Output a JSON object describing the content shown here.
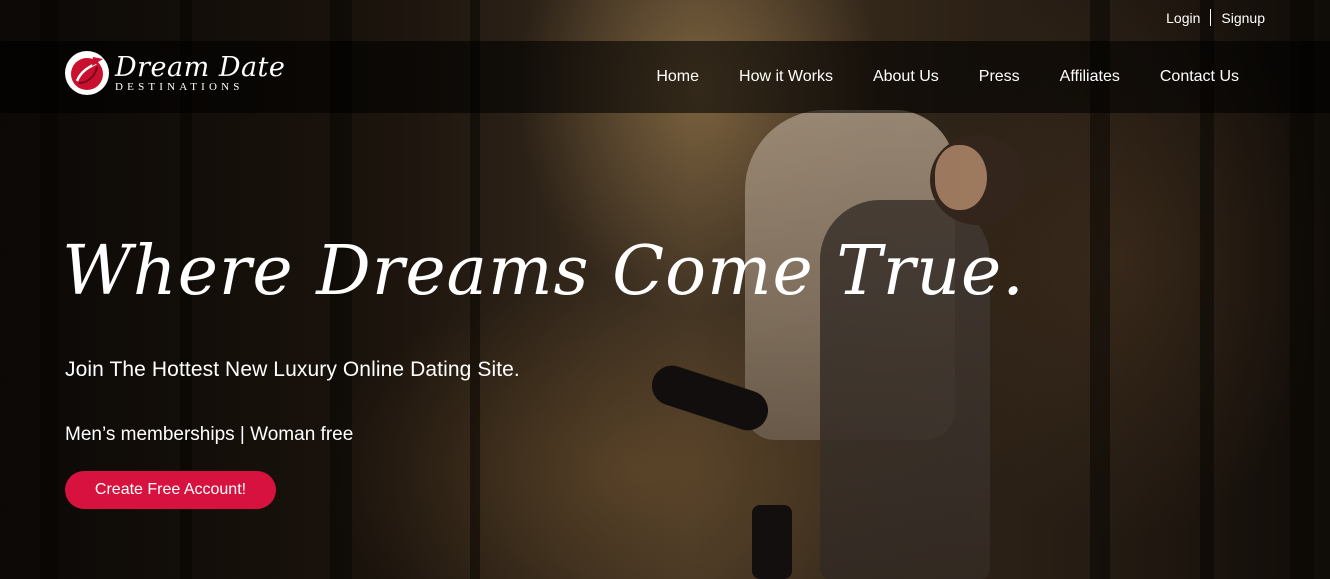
{
  "brand": {
    "name_script": "Dream Date",
    "name_sub": "DESTINATIONS",
    "accent_color": "#d8123f"
  },
  "top_links": {
    "login": "Login",
    "signup": "Signup"
  },
  "nav": {
    "items": [
      {
        "label": "Home"
      },
      {
        "label": "How it Works"
      },
      {
        "label": "About Us"
      },
      {
        "label": "Press"
      },
      {
        "label": "Affiliates"
      },
      {
        "label": "Contact Us"
      }
    ]
  },
  "hero": {
    "headline": "Where Dreams Come True.",
    "subline": "Join The Hottest New Luxury Online Dating Site.",
    "membership": "Men’s memberships | Woman free",
    "cta_label": "Create Free Account!"
  },
  "icons": {
    "logo": "airplane-heart-logo-icon"
  }
}
